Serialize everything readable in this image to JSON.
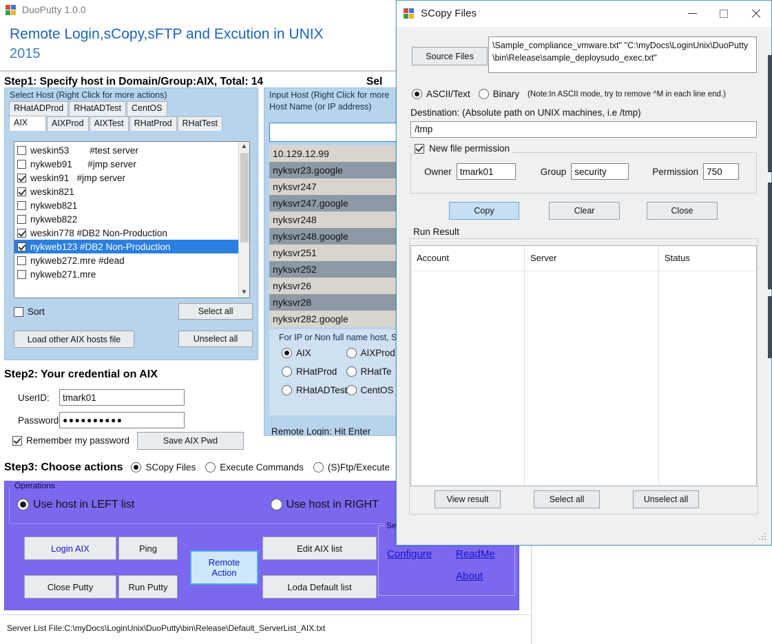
{
  "main_window": {
    "title": "DuoPutty 1.0.0",
    "icon": "app-logo-icon",
    "banner": {
      "headline": "Remote Login,sCopy,sFTP and Excution in UNIX",
      "year": "2015"
    },
    "step1": {
      "heading": "Step1: Specify host in Domain/Group:AIX, Total: 14",
      "right_clipped": "Sel"
    },
    "left_host_group": {
      "label": "Select Host (Right Click for more actions)",
      "tabs_row1": [
        "RHatADProd",
        "RHatADTest",
        "CentOS"
      ],
      "tabs_row2": [
        "AIX",
        "AIXProd",
        "AIXTest",
        "RHatProd",
        "RHatTest"
      ],
      "active_tab": "AIX",
      "hosts": [
        {
          "name": "weskin53",
          "comment": "        #test server",
          "checked": false,
          "selected": false
        },
        {
          "name": "nykweb91",
          "comment": "      #jmp server",
          "checked": false,
          "selected": false
        },
        {
          "name": "weskin91",
          "comment": "   #jmp server",
          "checked": true,
          "selected": false
        },
        {
          "name": "weskin821",
          "comment": "",
          "checked": true,
          "selected": false
        },
        {
          "name": "nykweb821",
          "comment": "",
          "checked": false,
          "selected": false
        },
        {
          "name": "nykweb822",
          "comment": "",
          "checked": false,
          "selected": false
        },
        {
          "name": "weskin778",
          "comment": " #DB2 Non-Production",
          "checked": true,
          "selected": false
        },
        {
          "name": "nykweb123",
          "comment": " #DB2 Non-Production",
          "checked": true,
          "selected": true
        },
        {
          "name": "nykweb272.mre",
          "comment": " #dead",
          "checked": false,
          "selected": false
        },
        {
          "name": "nykweb271.mre",
          "comment": "",
          "checked": false,
          "selected": false
        }
      ],
      "sort_label": "Sort",
      "sort_checked": false,
      "select_all_label": "Select all",
      "unselect_all_label": "Unselect all",
      "load_other_label": "Load other AIX hosts file"
    },
    "right_input_group": {
      "label_line1": "Input Host (Right Click for more",
      "label_line2": "Host Name (or IP address)",
      "input_value": "",
      "hosts": [
        "10.129.12.99",
        "nyksvr23.google",
        "nyksvr247",
        "nyksvr247.google",
        "nyksvr248",
        "nyksvr248.google",
        "nyksvr251",
        "nyksvr252",
        "nyksvr26",
        "nyksvr28",
        "nyksvr282.google"
      ],
      "radio_note": "For IP or Non full name host, Se",
      "radios": [
        {
          "label": "AIX",
          "selected": true
        },
        {
          "label": "AIXProd",
          "selected": false
        },
        {
          "label": "RHatProd",
          "selected": false
        },
        {
          "label": "RHatTe",
          "selected": false
        },
        {
          "label": "RHatADTest",
          "selected": false
        },
        {
          "label": "CentOS",
          "selected": false
        }
      ],
      "remote_login_hint": "Remote Login: Hit Enter"
    },
    "step2": {
      "heading": "Step2: Your credential on AIX",
      "userid_label": "UserID:",
      "userid_value": "tmark01",
      "password_label": "Password:",
      "password_value": "●●●●●●●●●●",
      "remember_label": "Remember my password",
      "remember_checked": true,
      "save_pwd_label": "Save AIX Pwd"
    },
    "step3": {
      "heading": "Step3: Choose actions",
      "options": [
        {
          "label": "SCopy Files",
          "selected": true
        },
        {
          "label": "Execute Commands",
          "selected": false
        },
        {
          "label": "(S)Ftp/Execute",
          "selected": false
        }
      ]
    },
    "operations": {
      "legend": "Operations",
      "scope_options": [
        {
          "label": "Use host in LEFT list",
          "selected": true
        },
        {
          "label": "Use host in RIGHT",
          "selected": false
        }
      ],
      "buttons": [
        {
          "key": "login_aix",
          "label": "Login AIX"
        },
        {
          "key": "ping",
          "label": "Ping"
        },
        {
          "key": "close_putty",
          "label": "Close Putty"
        },
        {
          "key": "run_putty",
          "label": "Run Putty"
        },
        {
          "key": "remote_action",
          "label": "Remote\nAction"
        },
        {
          "key": "edit_aix_list",
          "label": "Edit AIX list"
        },
        {
          "key": "load_default_list",
          "label": "Loda Default list"
        }
      ],
      "remote_action_line1": "Remote",
      "remote_action_line2": "Action",
      "settings_legend": "Sett",
      "links": [
        "Configure",
        "ReadMe",
        "About"
      ]
    },
    "statusbar": {
      "text": "Server List File:C:\\myDocs\\LoginUnix\\DuoPutty\\bin\\Release\\Default_ServerList_AIX.txt"
    }
  },
  "dialog": {
    "title": "SCopy Files",
    "icon": "app-logo-icon",
    "window_controls": {
      "minimize": "minimize-icon",
      "maximize": "maximize-icon",
      "close": "close-icon"
    },
    "source_files_button": "Source Files",
    "source_files_value": "\\Sample_compliance_vmware.txt'' \"C:\\myDocs\\LoginUnix\\DuoPutty\\bin\\Release\\sample_deploysudo_exec.txt\"",
    "mode_options": [
      {
        "label": "ASCII/Text",
        "selected": true
      },
      {
        "label": "Binary",
        "selected": false
      }
    ],
    "mode_note": "(Note:In ASCII mode, try to remove ^M in each line end.)",
    "destination_label": "Destination:   (Absolute path on UNIX machines, i.e  /tmp)",
    "destination_value": "/tmp",
    "new_file_permission": {
      "label": "New file permission",
      "checked": true,
      "owner_label": "Owner",
      "owner_value": "tmark01",
      "group_label": "Group",
      "group_value": "security",
      "permission_label": "Permission",
      "permission_value": "750"
    },
    "action_buttons": [
      {
        "key": "copy",
        "label": "Copy",
        "primary": true
      },
      {
        "key": "clear",
        "label": "Clear",
        "primary": false
      },
      {
        "key": "close",
        "label": "Close",
        "primary": false
      }
    ],
    "run_result": {
      "legend": "Run Result",
      "columns": [
        "Account",
        "Server",
        "Status"
      ],
      "rows": []
    },
    "footer_buttons": [
      {
        "key": "view_result",
        "label": "View result"
      },
      {
        "key": "select_all",
        "label": "Select all"
      },
      {
        "key": "unselect_all",
        "label": "Unselect all"
      }
    ]
  },
  "colors": {
    "accent_blue": "#1c63b8",
    "panel_blue": "#b8d3ec",
    "ops_purple": "#7b68ee",
    "selection_blue": "#2a7fe0",
    "dialog_border": "#4aa3c9"
  }
}
